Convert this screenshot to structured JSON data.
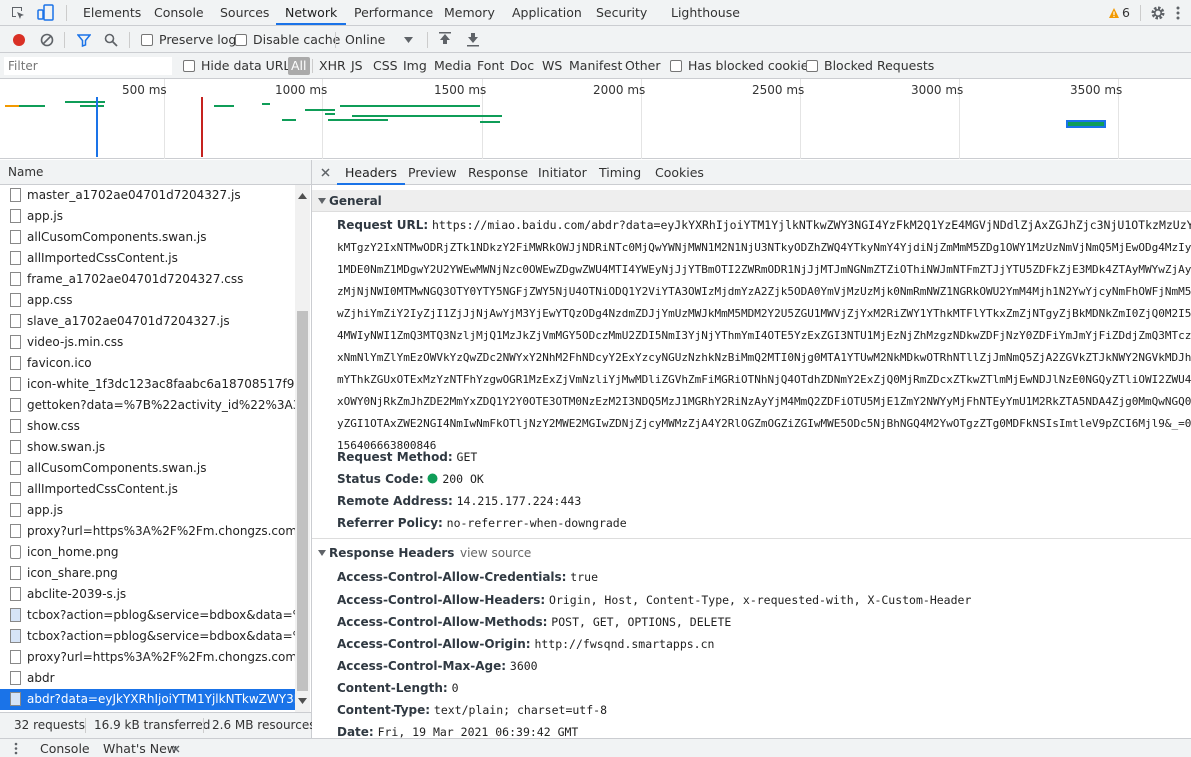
{
  "topbar": {
    "tabs": [
      "Elements",
      "Console",
      "Sources",
      "Network",
      "Performance",
      "Memory",
      "Application",
      "Security",
      "Lighthouse"
    ],
    "active_tab": "Network",
    "warning_count": "6"
  },
  "toolbar": {
    "preserve_log": "Preserve log",
    "disable_cache": "Disable cache",
    "throttle": "Online"
  },
  "filterbar": {
    "filter_placeholder": "Filter",
    "hide_data_urls": "Hide data URLs",
    "types": [
      "All",
      "XHR",
      "JS",
      "CSS",
      "Img",
      "Media",
      "Font",
      "Doc",
      "WS",
      "Manifest",
      "Other"
    ],
    "has_blocked_cookies": "Has blocked cookies",
    "blocked_requests": "Blocked Requests"
  },
  "timeline": {
    "labels": [
      "500 ms",
      "1000 ms",
      "1500 ms",
      "2000 ms",
      "2500 ms",
      "3000 ms",
      "3500 ms"
    ]
  },
  "requests": {
    "header": "Name",
    "items": [
      "master_a1702ae04701d7204327.js",
      "app.js",
      "allCusomComponents.swan.js",
      "allImportedCssContent.js",
      "frame_a1702ae04701d7204327.css",
      "app.css",
      "slave_a1702ae04701d7204327.js",
      "video-js.min.css",
      "favicon.ico",
      "icon-white_1f3dc123ac8faabc6a18708517f925d7.p",
      "gettoken?data=%7B%22activity_id%22%3A352%2",
      "show.css",
      "show.swan.js",
      "allCusomComponents.swan.js",
      "allImportedCssContent.js",
      "app.js",
      "proxy?url=https%3A%2F%2Fm.chongzs.com%2Fap",
      "icon_home.png",
      "icon_share.png",
      "abclite-2039-s.js",
      "tcbox?action=pblog&service=bdbox&data=%7B%",
      "tcbox?action=pblog&service=bdbox&data=%7B%",
      "proxy?url=https%3A%2F%2Fm.chongzs.com%2Fap",
      "abdr",
      "abdr?data=eyJkYXRhIjoiYTM1YjlkNTkwZWY3NGI4..."
    ],
    "selected_index": 24
  },
  "status": {
    "requests": "32 requests",
    "transferred": "16.9 kB transferred",
    "resources": "2.6 MB resources"
  },
  "detail_tabs": {
    "tabs": [
      "Headers",
      "Preview",
      "Response",
      "Initiator",
      "Timing",
      "Cookies"
    ],
    "active": "Headers"
  },
  "general": {
    "title": "General",
    "request_url_key": "Request URL:",
    "request_url_lines": [
      "https://miao.baidu.com/abdr?data=eyJkYXRhIjoiYTM1YjlkNTkwZWY3NGI4YzFkM2Q1YzE4MGVjNDdlZjAxZGJhZjc3NjU1OTkzMzUzYTM3OWY4",
      "kMTgzY2IxNTMwODRjZTk1NDkzY2FiMWRkOWJjNDRiNTc0MjQwYWNjMWN1M2N1NjU3NTkyODZhZWQ4YTkyNmY4YjdiNjZmMmM5ZDg1OWY1MzUzNmVjNmQ5MjEwODg4MzIyZ",
      "1MDE0NmZ1MDgwY2U2YWEwMWNjNzc0OWEwZDgwZWU4MTI4YWEyNjJjYTBmOTI2ZWRmODR1NjJjMTJmNGNmZTZiOThiNWJmNTFmZTJjYTU5ZDFkZjE3MDk4ZTAyMWYwZjAyY",
      "zMjNjNWI0MTMwNGQ3OTY0YTY5NGFjZWY5NjU4OTNiODQ1Y2ViYTA3OWIzMjdmYzA2Zjk5ODA0YmVjMzUzMjk0NmRmNWZ1NGRkOWU2YmM4Mjh1N2YwYjcyNmFhOWFjNmM5",
      "wZjhiYmZiY2IyZjI1ZjJjNjAwYjM3YjEwYTQzODg4NzdmZDJjYmUzMWJkMmM5MDM2Y2U5ZGU1MWVjZjYxM2RiZWY1YThkMTFlYTkxZmZjNTgyZjBkMDNkZmI0ZjQ0M2I5N",
      "4MWIyNWI1ZmQ3MTQ3NzljMjQ1MzJkZjVmMGY5ODczMmU2ZDI5NmI3YjNjYThmYmI4OTE5YzExZGI3NTU1MjEzNjZhMzgzNDkwZDFjNzY0ZDFiYmJmYjFiZDdjZmQ3MTczM",
      "xNmNlYmZlYmEzOWVkYzQwZDc2NWYxY2NhM2FhNDcyY2ExYzcyNGUzNzhkNzBiMmQ2MTI0Njg0MTA1YTUwM2NkMDkwOTRhNTllZjJmNmQ5ZjA2ZGVkZTJkNWY2NGVkMDJhM",
      "mYThkZGUxOTExMzYzNTFhYzgwOGR1MzExZjVmNzliYjMwMDliZGVhZmFiMGRiOTNhNjQ4OTdhZDNmY2ExZjQ0MjRmZDcxZTkwZTlmMjEwNDJlNzE0NGQyZTliOWI2ZWU4M",
      "xOWY0NjRkZmJhZDE2MmYxZDQ1Y2Y0OTE3OTM0NzEzM2I3NDQ5MzJ1MGRhY2RiNzAyYjM4MmQ2ZDFiOTU5MjE1ZmY2NWYyMjFhNTEyYmU1M2RkZTA5NDA4Zjg0MmQwNGQ0M",
      "yZGI1OTAxZWE2NGI4NmIwNmFkOTljNzY2MWE2MGIwZDNjZjcyMWMzZjA4Y2RlOGZmOGZiZGIwMWE5ODc5NjBhNGQ4M2YwOTgzZTg0MDFkNSIsImtleV9pZCI6Mjl9&_=0.",
      "156406663800846"
    ],
    "request_method_key": "Request Method:",
    "request_method": "GET",
    "status_code_key": "Status Code:",
    "status_code": "200 OK",
    "remote_address_key": "Remote Address:",
    "remote_address": "14.215.177.224:443",
    "referrer_policy_key": "Referrer Policy:",
    "referrer_policy": "no-referrer-when-downgrade"
  },
  "response_headers": {
    "title": "Response Headers",
    "view_source": "view source",
    "items": [
      {
        "k": "Access-Control-Allow-Credentials:",
        "v": "true"
      },
      {
        "k": "Access-Control-Allow-Headers:",
        "v": "Origin, Host, Content-Type, x-requested-with, X-Custom-Header"
      },
      {
        "k": "Access-Control-Allow-Methods:",
        "v": "POST, GET, OPTIONS, DELETE"
      },
      {
        "k": "Access-Control-Allow-Origin:",
        "v": "http://fwsqnd.smartapps.cn"
      },
      {
        "k": "Access-Control-Max-Age:",
        "v": "3600"
      },
      {
        "k": "Content-Length:",
        "v": "0"
      },
      {
        "k": "Content-Type:",
        "v": "text/plain; charset=utf-8"
      },
      {
        "k": "Date:",
        "v": "Fri, 19 Mar 2021 06:39:42 GMT"
      }
    ]
  },
  "drawer": {
    "tabs": [
      "Console",
      "What's New"
    ]
  },
  "colors": {
    "accent": "#1a73e8",
    "record": "#d93025",
    "status_ok": "#0f9d58",
    "warning": "#f29900"
  }
}
